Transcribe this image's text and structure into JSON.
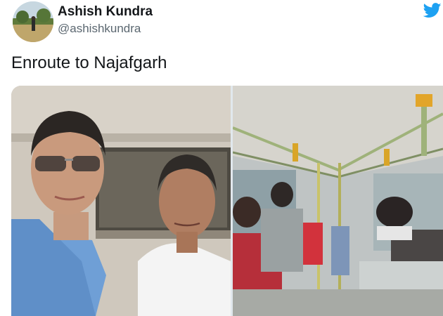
{
  "tweet": {
    "author": {
      "display_name": "Ashish Kundra",
      "handle": "@ashishkundra",
      "avatar_icon": "profile-photo"
    },
    "text": "Enroute to Najafgarh",
    "platform_icon": "twitter-bird-icon",
    "brand_color": "#1da1f2",
    "media": [
      {
        "kind": "photo",
        "description_icon": "selfie-photo"
      },
      {
        "kind": "photo",
        "description_icon": "bus-interior-photo"
      }
    ]
  }
}
